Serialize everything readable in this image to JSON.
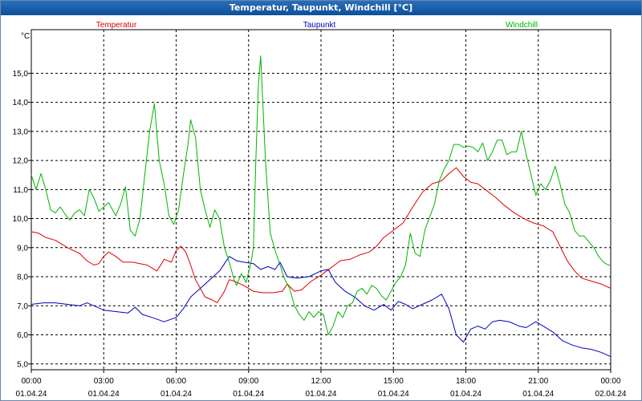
{
  "window": {
    "title": "Temperatur, Taupunkt, Windchill [°C]"
  },
  "colors": {
    "temperature": "#dd0000",
    "dewpoint": "#0000c0",
    "windchill": "#00b400",
    "grid": "#000000",
    "background": "#ffffff"
  },
  "chart_data": {
    "type": "line",
    "title": "Temperatur, Taupunkt, Windchill [°C]",
    "ylabel": "°C",
    "xlabel": "",
    "ylim": [
      4.8,
      16.5
    ],
    "xlim": [
      0,
      24
    ],
    "grid": true,
    "legend_placement": "top",
    "y_ticks": [
      "5,0",
      "6,0",
      "7,0",
      "8,0",
      "9,0",
      "10,0",
      "11,0",
      "12,0",
      "13,0",
      "14,0",
      "15,0"
    ],
    "y_tick_values": [
      5,
      6,
      7,
      8,
      9,
      10,
      11,
      12,
      13,
      14,
      15
    ],
    "x_tick_hours": [
      0,
      3,
      6,
      9,
      12,
      15,
      18,
      21,
      24
    ],
    "x_tick_times": [
      "00:00",
      "03:00",
      "06:00",
      "09:00",
      "12:00",
      "15:00",
      "18:00",
      "21:00",
      "00:00"
    ],
    "x_tick_dates": [
      "01.04.24",
      "01.04.24",
      "01.04.24",
      "01.04.24",
      "01.04.24",
      "01.04.24",
      "01.04.24",
      "01.04.24",
      "02.04.24"
    ],
    "series": [
      {
        "name": "Temperatur",
        "color": "#dd0000",
        "points": [
          [
            0,
            9.55
          ],
          [
            0.3,
            9.5
          ],
          [
            0.6,
            9.35
          ],
          [
            1.0,
            9.25
          ],
          [
            1.5,
            9.0
          ],
          [
            2.0,
            8.8
          ],
          [
            2.3,
            8.55
          ],
          [
            2.6,
            8.4
          ],
          [
            2.8,
            8.45
          ],
          [
            3.0,
            8.7
          ],
          [
            3.2,
            8.85
          ],
          [
            3.5,
            8.7
          ],
          [
            3.8,
            8.5
          ],
          [
            4.2,
            8.5
          ],
          [
            4.5,
            8.45
          ],
          [
            4.8,
            8.4
          ],
          [
            5.0,
            8.3
          ],
          [
            5.2,
            8.2
          ],
          [
            5.4,
            8.45
          ],
          [
            5.5,
            8.6
          ],
          [
            5.8,
            8.5
          ],
          [
            6.0,
            8.9
          ],
          [
            6.2,
            9.05
          ],
          [
            6.4,
            8.85
          ],
          [
            6.6,
            8.4
          ],
          [
            6.8,
            7.9
          ],
          [
            7.0,
            7.6
          ],
          [
            7.2,
            7.3
          ],
          [
            7.5,
            7.2
          ],
          [
            7.7,
            7.1
          ],
          [
            8.0,
            7.5
          ],
          [
            8.2,
            7.9
          ],
          [
            8.4,
            7.85
          ],
          [
            8.8,
            7.7
          ],
          [
            9.2,
            7.5
          ],
          [
            9.6,
            7.45
          ],
          [
            10.0,
            7.45
          ],
          [
            10.4,
            7.5
          ],
          [
            10.6,
            7.75
          ],
          [
            10.9,
            7.5
          ],
          [
            11.2,
            7.55
          ],
          [
            11.6,
            7.85
          ],
          [
            12.0,
            8.05
          ],
          [
            12.4,
            8.3
          ],
          [
            12.8,
            8.55
          ],
          [
            13.2,
            8.6
          ],
          [
            13.6,
            8.75
          ],
          [
            14.0,
            8.85
          ],
          [
            14.3,
            9.05
          ],
          [
            14.6,
            9.35
          ],
          [
            15.0,
            9.6
          ],
          [
            15.4,
            9.85
          ],
          [
            15.8,
            10.4
          ],
          [
            16.2,
            10.9
          ],
          [
            16.6,
            11.2
          ],
          [
            17.0,
            11.3
          ],
          [
            17.3,
            11.55
          ],
          [
            17.6,
            11.75
          ],
          [
            17.9,
            11.45
          ],
          [
            18.2,
            11.25
          ],
          [
            18.5,
            11.2
          ],
          [
            18.8,
            11.0
          ],
          [
            19.2,
            10.75
          ],
          [
            19.6,
            10.45
          ],
          [
            20.0,
            10.2
          ],
          [
            20.4,
            10.0
          ],
          [
            20.8,
            9.85
          ],
          [
            21.2,
            9.75
          ],
          [
            21.6,
            9.55
          ],
          [
            21.9,
            9.05
          ],
          [
            22.2,
            8.55
          ],
          [
            22.5,
            8.2
          ],
          [
            22.8,
            7.95
          ],
          [
            23.2,
            7.85
          ],
          [
            23.6,
            7.75
          ],
          [
            24.0,
            7.6
          ]
        ]
      },
      {
        "name": "Taupunkt",
        "color": "#0000c0",
        "points": [
          [
            0,
            7.05
          ],
          [
            0.5,
            7.1
          ],
          [
            1.0,
            7.1
          ],
          [
            1.5,
            7.05
          ],
          [
            2.0,
            7.0
          ],
          [
            2.3,
            7.1
          ],
          [
            2.6,
            7.0
          ],
          [
            3.0,
            6.85
          ],
          [
            3.5,
            6.8
          ],
          [
            4.0,
            6.75
          ],
          [
            4.3,
            6.95
          ],
          [
            4.6,
            6.7
          ],
          [
            5.0,
            6.6
          ],
          [
            5.5,
            6.45
          ],
          [
            6.0,
            6.6
          ],
          [
            6.3,
            6.9
          ],
          [
            6.6,
            7.3
          ],
          [
            7.0,
            7.6
          ],
          [
            7.4,
            7.9
          ],
          [
            7.8,
            8.2
          ],
          [
            8.2,
            8.7
          ],
          [
            8.5,
            8.55
          ],
          [
            8.8,
            8.5
          ],
          [
            9.2,
            8.45
          ],
          [
            9.5,
            8.25
          ],
          [
            9.8,
            8.35
          ],
          [
            10.1,
            8.25
          ],
          [
            10.3,
            8.5
          ],
          [
            10.6,
            8.0
          ],
          [
            11.0,
            7.95
          ],
          [
            11.5,
            8.0
          ],
          [
            12.0,
            8.2
          ],
          [
            12.3,
            8.25
          ],
          [
            12.6,
            7.8
          ],
          [
            13.0,
            7.5
          ],
          [
            13.4,
            7.3
          ],
          [
            13.8,
            7.0
          ],
          [
            14.2,
            6.85
          ],
          [
            14.6,
            7.05
          ],
          [
            14.9,
            6.85
          ],
          [
            15.2,
            7.15
          ],
          [
            15.5,
            7.05
          ],
          [
            15.8,
            6.9
          ],
          [
            16.2,
            7.05
          ],
          [
            16.6,
            7.2
          ],
          [
            17.0,
            7.4
          ],
          [
            17.3,
            6.9
          ],
          [
            17.6,
            6.0
          ],
          [
            17.9,
            5.75
          ],
          [
            18.2,
            6.2
          ],
          [
            18.5,
            6.3
          ],
          [
            18.8,
            6.2
          ],
          [
            19.1,
            6.45
          ],
          [
            19.4,
            6.5
          ],
          [
            19.8,
            6.45
          ],
          [
            20.2,
            6.3
          ],
          [
            20.5,
            6.25
          ],
          [
            20.9,
            6.45
          ],
          [
            21.2,
            6.3
          ],
          [
            21.6,
            6.1
          ],
          [
            22.0,
            5.8
          ],
          [
            22.4,
            5.65
          ],
          [
            22.8,
            5.55
          ],
          [
            23.2,
            5.5
          ],
          [
            23.6,
            5.4
          ],
          [
            24.0,
            5.25
          ]
        ]
      },
      {
        "name": "Windchill",
        "color": "#00b400",
        "points": [
          [
            0,
            11.5
          ],
          [
            0.2,
            11.0
          ],
          [
            0.4,
            11.55
          ],
          [
            0.6,
            11.0
          ],
          [
            0.8,
            10.3
          ],
          [
            1.0,
            10.2
          ],
          [
            1.2,
            10.4
          ],
          [
            1.4,
            10.15
          ],
          [
            1.6,
            9.95
          ],
          [
            1.8,
            10.2
          ],
          [
            2.0,
            10.3
          ],
          [
            2.2,
            10.1
          ],
          [
            2.4,
            11.0
          ],
          [
            2.6,
            10.7
          ],
          [
            2.8,
            10.25
          ],
          [
            3.0,
            10.4
          ],
          [
            3.2,
            10.55
          ],
          [
            3.5,
            10.1
          ],
          [
            3.7,
            10.5
          ],
          [
            3.9,
            11.1
          ],
          [
            4.1,
            9.6
          ],
          [
            4.3,
            9.4
          ],
          [
            4.5,
            10.0
          ],
          [
            4.7,
            11.5
          ],
          [
            4.9,
            13.0
          ],
          [
            5.1,
            13.95
          ],
          [
            5.3,
            12.0
          ],
          [
            5.5,
            11.2
          ],
          [
            5.7,
            10.1
          ],
          [
            5.9,
            9.8
          ],
          [
            6.1,
            10.3
          ],
          [
            6.3,
            11.5
          ],
          [
            6.5,
            12.6
          ],
          [
            6.6,
            13.4
          ],
          [
            6.8,
            12.8
          ],
          [
            7.0,
            11.0
          ],
          [
            7.2,
            10.3
          ],
          [
            7.4,
            9.7
          ],
          [
            7.6,
            10.3
          ],
          [
            7.8,
            10.0
          ],
          [
            8.0,
            9.0
          ],
          [
            8.2,
            8.5
          ],
          [
            8.4,
            7.9
          ],
          [
            8.5,
            7.7
          ],
          [
            8.7,
            8.1
          ],
          [
            8.9,
            7.8
          ],
          [
            9.1,
            8.5
          ],
          [
            9.2,
            9.0
          ],
          [
            9.3,
            12.0
          ],
          [
            9.4,
            14.5
          ],
          [
            9.5,
            15.6
          ],
          [
            9.7,
            12.0
          ],
          [
            9.9,
            9.5
          ],
          [
            10.1,
            8.9
          ],
          [
            10.3,
            8.4
          ],
          [
            10.5,
            7.9
          ],
          [
            10.7,
            7.6
          ],
          [
            10.9,
            7.0
          ],
          [
            11.1,
            6.7
          ],
          [
            11.3,
            6.5
          ],
          [
            11.5,
            6.8
          ],
          [
            11.7,
            6.6
          ],
          [
            11.9,
            6.8
          ],
          [
            12.1,
            6.7
          ],
          [
            12.3,
            6.0
          ],
          [
            12.5,
            6.3
          ],
          [
            12.7,
            6.8
          ],
          [
            12.9,
            6.6
          ],
          [
            13.1,
            7.0
          ],
          [
            13.3,
            7.1
          ],
          [
            13.5,
            7.5
          ],
          [
            13.7,
            7.6
          ],
          [
            13.9,
            7.4
          ],
          [
            14.1,
            7.7
          ],
          [
            14.3,
            7.6
          ],
          [
            14.5,
            7.35
          ],
          [
            14.7,
            7.2
          ],
          [
            14.9,
            7.5
          ],
          [
            15.1,
            7.8
          ],
          [
            15.3,
            8.0
          ],
          [
            15.5,
            8.4
          ],
          [
            15.7,
            9.5
          ],
          [
            15.9,
            8.8
          ],
          [
            16.1,
            8.7
          ],
          [
            16.3,
            9.6
          ],
          [
            16.5,
            10.05
          ],
          [
            16.7,
            10.5
          ],
          [
            16.9,
            11.3
          ],
          [
            17.1,
            11.7
          ],
          [
            17.3,
            12.0
          ],
          [
            17.5,
            12.55
          ],
          [
            17.7,
            12.55
          ],
          [
            17.9,
            12.45
          ],
          [
            18.1,
            12.5
          ],
          [
            18.3,
            12.45
          ],
          [
            18.5,
            12.3
          ],
          [
            18.7,
            12.6
          ],
          [
            18.9,
            12.0
          ],
          [
            19.1,
            12.3
          ],
          [
            19.3,
            12.7
          ],
          [
            19.5,
            12.7
          ],
          [
            19.7,
            12.2
          ],
          [
            19.9,
            12.3
          ],
          [
            20.1,
            12.3
          ],
          [
            20.3,
            13.0
          ],
          [
            20.5,
            12.2
          ],
          [
            20.7,
            11.5
          ],
          [
            20.9,
            10.8
          ],
          [
            21.1,
            11.2
          ],
          [
            21.3,
            11.0
          ],
          [
            21.5,
            11.3
          ],
          [
            21.7,
            11.8
          ],
          [
            21.9,
            11.2
          ],
          [
            22.1,
            10.5
          ],
          [
            22.3,
            10.2
          ],
          [
            22.5,
            9.6
          ],
          [
            22.7,
            9.4
          ],
          [
            22.9,
            9.4
          ],
          [
            23.1,
            9.2
          ],
          [
            23.3,
            9.0
          ],
          [
            23.5,
            8.7
          ],
          [
            23.7,
            8.5
          ],
          [
            23.9,
            8.4
          ],
          [
            24.0,
            8.4
          ]
        ]
      }
    ]
  }
}
